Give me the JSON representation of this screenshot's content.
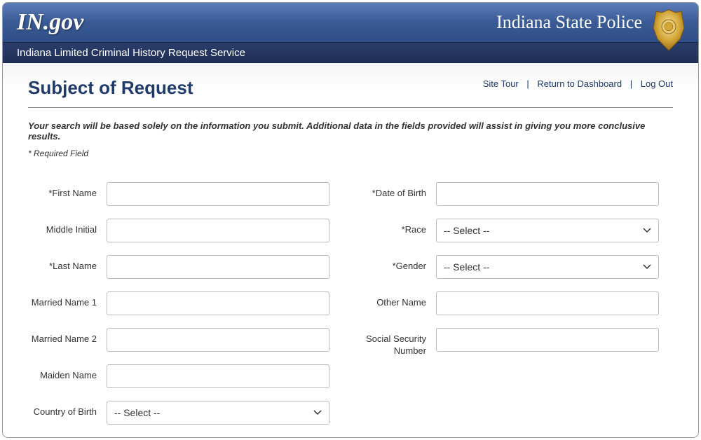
{
  "header": {
    "logo": "IN.gov",
    "agency": "Indiana State Police",
    "subtitle": "Indiana Limited Criminal History Request Service"
  },
  "nav": {
    "site_tour": "Site Tour",
    "return_dashboard": "Return to Dashboard",
    "log_out": "Log Out"
  },
  "page": {
    "title": "Subject of Request",
    "instructions": "Your search will be based solely on the information you submit. Additional data in the fields provided will assist in giving you more conclusive results.",
    "required_note": "* Required Field"
  },
  "form": {
    "left": {
      "first_name": {
        "label": "*First Name",
        "value": ""
      },
      "middle_initial": {
        "label": "Middle Initial",
        "value": ""
      },
      "last_name": {
        "label": "*Last Name",
        "value": ""
      },
      "married_name_1": {
        "label": "Married Name 1",
        "value": ""
      },
      "married_name_2": {
        "label": "Married Name 2",
        "value": ""
      },
      "maiden_name": {
        "label": "Maiden Name",
        "value": ""
      },
      "country_of_birth": {
        "label": "Country of Birth",
        "selected": "-- Select --"
      }
    },
    "right": {
      "dob": {
        "label": "*Date of Birth",
        "value": ""
      },
      "race": {
        "label": "*Race",
        "selected": "-- Select --"
      },
      "gender": {
        "label": "*Gender",
        "selected": "-- Select --"
      },
      "other_name": {
        "label": "Other Name",
        "value": ""
      },
      "ssn": {
        "label": "Social Security Number",
        "value": ""
      }
    }
  }
}
